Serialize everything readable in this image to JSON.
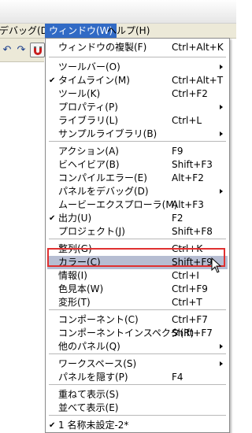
{
  "menubar": {
    "items": [
      {
        "label": "デバッグ(D)"
      },
      {
        "label": "ウィンドウ(W)"
      },
      {
        "label": "ヘルプ(H)"
      }
    ]
  },
  "toolbar": {
    "icons": [
      "undo-arrow-icon",
      "redo-arrow-icon",
      "magnet-snap-icon"
    ]
  },
  "menu": {
    "items": [
      {
        "label": "ウィンドウの複製(F)",
        "shortcut": "Ctrl+Alt+K"
      },
      {
        "label": "ツールバー(O)",
        "shortcut": ""
      },
      {
        "label": "タイムライン(M)",
        "shortcut": "Ctrl+Alt+T",
        "checked": true
      },
      {
        "label": "ツール(K)",
        "shortcut": "Ctrl+F2"
      },
      {
        "label": "プロパティ(P)",
        "shortcut": ""
      },
      {
        "label": "ライブラリ(L)",
        "shortcut": "Ctrl+L"
      },
      {
        "label": "サンプルライブラリ(B)",
        "shortcut": ""
      },
      {
        "label": "アクション(A)",
        "shortcut": "F9"
      },
      {
        "label": "ビヘイビア(B)",
        "shortcut": "Shift+F3"
      },
      {
        "label": "コンパイルエラー(E)",
        "shortcut": "Alt+F2"
      },
      {
        "label": "パネルをデバッグ(D)",
        "shortcut": ""
      },
      {
        "label": "ムービーエクスプローラ(M)",
        "shortcut": "Alt+F3"
      },
      {
        "label": "出力(U)",
        "shortcut": "F2",
        "checked": true
      },
      {
        "label": "プロジェクト(J)",
        "shortcut": "Shift+F8"
      },
      {
        "label": "整列(G)",
        "shortcut": "Ctrl+K"
      },
      {
        "label": "カラー(C)",
        "shortcut": "Shift+F9",
        "highlighted": true
      },
      {
        "label": "情報(I)",
        "shortcut": "Ctrl+I"
      },
      {
        "label": "色見本(W)",
        "shortcut": "Ctrl+F9"
      },
      {
        "label": "変形(T)",
        "shortcut": "Ctrl+T"
      },
      {
        "label": "コンポーネント(C)",
        "shortcut": "Ctrl+F7"
      },
      {
        "label": "コンポーネントインスペクタ(R)",
        "shortcut": "Shift+F7"
      },
      {
        "label": "他のパネル(Q)",
        "shortcut": ""
      },
      {
        "label": "ワークスペース(S)",
        "shortcut": ""
      },
      {
        "label": "パネルを隠す(P)",
        "shortcut": "F4"
      },
      {
        "label": "重ねて表示(S)",
        "shortcut": ""
      },
      {
        "label": "並べて表示(E)",
        "shortcut": ""
      },
      {
        "label": "1 名称未設定-2*",
        "shortcut": "",
        "checked": true
      }
    ]
  },
  "colors": {
    "menu_highlight": "#b6bdd2",
    "annotation_box": "#e03030",
    "menubar_active": "#316ac5"
  }
}
